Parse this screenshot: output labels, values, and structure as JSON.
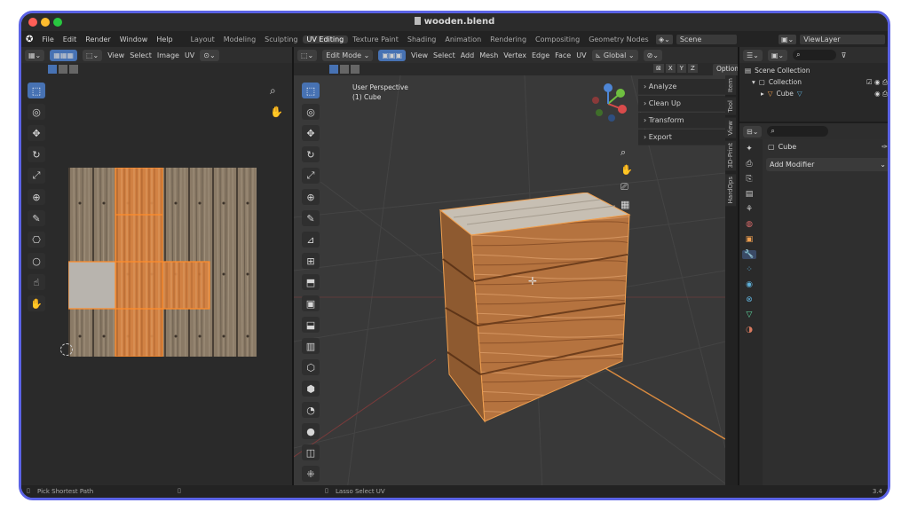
{
  "window": {
    "title": "wooden.blend",
    "file_icon": "document-icon"
  },
  "menu": {
    "items": [
      "File",
      "Edit",
      "Render",
      "Window",
      "Help"
    ],
    "workspaces": [
      "Layout",
      "Modeling",
      "Sculpting",
      "UV Editing",
      "Texture Paint",
      "Shading",
      "Animation",
      "Rendering",
      "Compositing",
      "Geometry Nodes"
    ],
    "active_workspace": "UV Editing",
    "scene_label": "Scene",
    "view_layer_label": "ViewLayer"
  },
  "uv_editor": {
    "menus": [
      "View",
      "Select",
      "Image",
      "UV"
    ]
  },
  "viewport": {
    "mode": "Edit Mode",
    "menus": [
      "View",
      "Select",
      "Add",
      "Mesh",
      "Vertex",
      "Edge",
      "Face",
      "UV"
    ],
    "transform_orientation": "Global",
    "options_label": "Options",
    "axis_buttons": [
      "X",
      "Y",
      "Z"
    ],
    "overlay_title": "User Perspective",
    "overlay_object": "(1) Cube",
    "npanel": [
      "Analyze",
      "Clean Up",
      "Transform",
      "Export"
    ],
    "vertical_tabs": [
      "Item",
      "Tool",
      "View",
      "3D-Print",
      "HardOps"
    ],
    "gizmo": {
      "x_color": "#d94b4b",
      "y_color": "#6fbf40",
      "z_color": "#4e86d6"
    }
  },
  "outliner": {
    "scene_collection": "Scene Collection",
    "collection": "Collection",
    "object": "Cube"
  },
  "properties": {
    "object_name": "Cube",
    "add_modifier": "Add Modifier"
  },
  "status": {
    "left": "Pick Shortest Path",
    "middle": "Lasso Select UV",
    "right": "3.4"
  },
  "colors": {
    "accent": "#4772b3",
    "frame_border": "#5b63e6",
    "selection_orange": "#d9823f"
  }
}
